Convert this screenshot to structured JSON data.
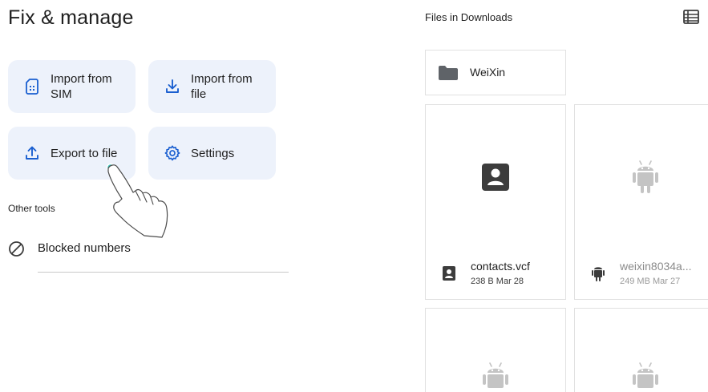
{
  "left_panel": {
    "title": "Fix & manage",
    "actions": [
      {
        "label": "Import from SIM",
        "icon": "sim-card-icon"
      },
      {
        "label": "Import from file",
        "icon": "download-icon"
      },
      {
        "label": "Export to file",
        "icon": "upload-icon"
      },
      {
        "label": "Settings",
        "icon": "gear-icon"
      }
    ],
    "other_tools_label": "Other tools",
    "blocked_numbers_label": "Blocked numbers"
  },
  "right_panel": {
    "title": "Files in Downloads",
    "view_toggle_icon": "list-view-icon",
    "folder": {
      "name": "WeiXin",
      "icon": "folder-icon"
    },
    "files": [
      {
        "name": "contacts.vcf",
        "size": "238 B",
        "date": "Mar 28",
        "sub": "238 B Mar 28",
        "icon": "contact-file-icon"
      },
      {
        "name": "weixin8034a...",
        "size": "249 MB",
        "date": "Mar 27",
        "sub": "249 MB Mar 27",
        "icon": "android-icon"
      }
    ]
  },
  "colors": {
    "card_bg": "#edf2fb",
    "accent_blue": "#1a5fd0",
    "icon_gray": "#5f6368",
    "android_gray": "#c4c4c4",
    "tap_indicator": "#3ec8c0"
  }
}
